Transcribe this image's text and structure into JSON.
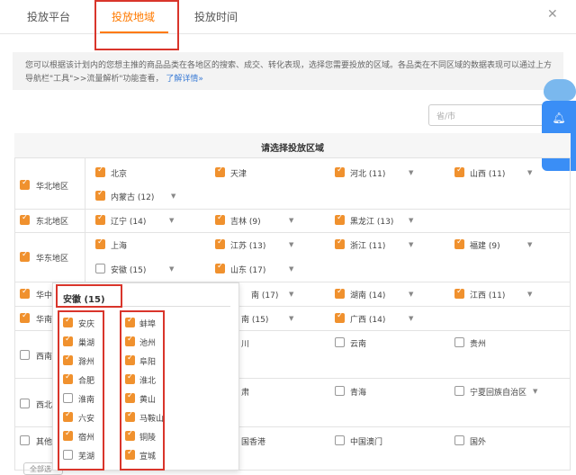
{
  "tabs": [
    {
      "label": "投放平台"
    },
    {
      "label": "投放地域"
    },
    {
      "label": "投放时间"
    }
  ],
  "info": {
    "text": "您可以根据该计划内的您想主推的商品品类在各地区的搜索、成交、转化表现，选择您需要投放的区域。各品类在不同区域的数据表现可以通过上方导航栏\"工具\">>流量解析\"功能查看，",
    "link": "了解详情»"
  },
  "search": {
    "placeholder": "省/市"
  },
  "table": {
    "title": "请选择投放区域"
  },
  "regions": {
    "huabei": "华北地区",
    "dongbei": "东北地区",
    "huadong": "华东地区",
    "huazhong": "华中地",
    "huanan": "华南地",
    "xinan": "西南地",
    "xibei": "西北地",
    "qita": "其他地"
  },
  "provinces": {
    "beijing": "北京",
    "tianjin": "天津",
    "hebei": "河北 (11)",
    "shanxi": "山西 (11)",
    "neimenggu": "内蒙古 (12)",
    "liaoning": "辽宁 (14)",
    "jilin": "吉林 (9)",
    "heilongjiang": "黑龙江 (13)",
    "shanghai": "上海",
    "jiangsu": "江苏 (13)",
    "zhejiang": "浙江 (11)",
    "fujian": "福建 (9)",
    "anhui": "安徽 (15)",
    "shandong": "山东 (17)",
    "henan": "南 (17)",
    "hunan": "湖南 (14)",
    "jiangxi": "江西 (11)",
    "guangdong": "南 (15)",
    "guangxi": "广西 (14)",
    "sichuan": "川",
    "yunnan": "云南",
    "guizhou": "贵州",
    "gansu": "肃",
    "qinghai": "青海",
    "ningxia": "宁夏回族自治区",
    "hongkong": "国香港",
    "macao": "中国澳门",
    "guowai": "国外"
  },
  "popup": {
    "title": "安徽 (15)",
    "left": [
      "安庆",
      "巢湖",
      "滁州",
      "合肥",
      "淮南",
      "六安",
      "宿州",
      "芜湖"
    ],
    "right": [
      "蚌埠",
      "池州",
      "阜阳",
      "淮北",
      "黄山",
      "马鞍山",
      "铜陵",
      "宣城"
    ]
  },
  "footer": {
    "button": "全部选"
  },
  "colors": {
    "accent": "#ff7a00",
    "checkbox": "#f0912e",
    "highlight": "#d9352b",
    "float": "#3a8ef6"
  },
  "icons": [
    "bell-icon",
    "message-icon",
    "close-icon",
    "chevron-down-icon"
  ]
}
